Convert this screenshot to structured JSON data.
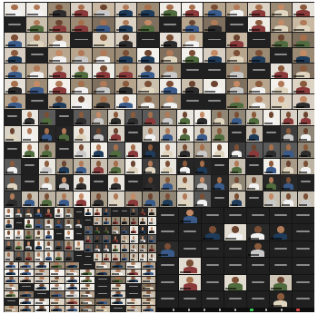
{
  "window": {
    "title": ""
  },
  "panels": [
    {
      "id": "panel-top",
      "cols": 14,
      "rows": 7,
      "tone": "warm"
    },
    {
      "id": "panel-mid",
      "cols": 18,
      "rows": 6,
      "tone": "mixed"
    },
    {
      "id": "panel-bottom-left",
      "cols": 10,
      "rows": 7,
      "tone": "warm"
    },
    {
      "id": "panel-left-lower",
      "cols": 8,
      "rows": 5,
      "tone": "mixed"
    },
    {
      "id": "panel-main",
      "cols": 7,
      "rows": 6,
      "tone": "zoom"
    }
  ],
  "toolbar": {
    "icons": [
      "mute-icon",
      "video-icon",
      "security-icon",
      "participants-icon",
      "chat-icon",
      "share-screen-icon",
      "record-icon",
      "reactions-icon",
      "leave-icon"
    ]
  },
  "colors": {
    "panel_bg": "#1e1e1e",
    "tile_blank": "#202020",
    "toolbar_green": "#3ccf5a",
    "toolbar_red": "#e24a4a"
  }
}
